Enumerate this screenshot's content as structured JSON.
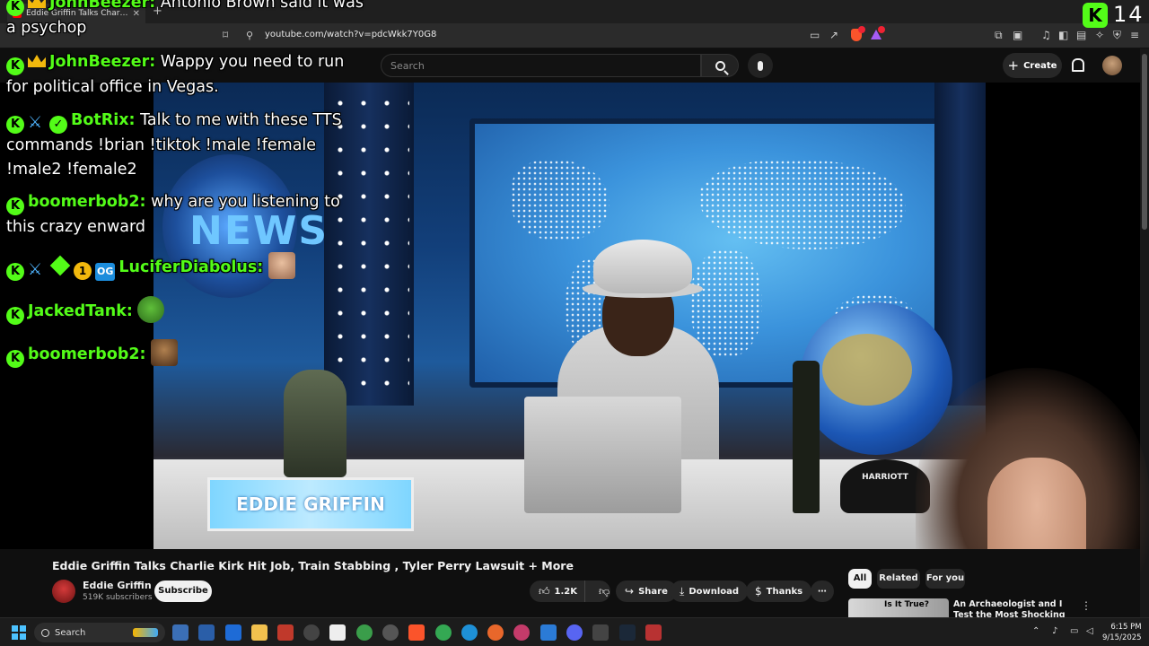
{
  "browser": {
    "tab_title": "Eddie Griffin Talks Charlie Kirk...",
    "url": "youtube.com/watch?v=pdcWkk7Y0G8"
  },
  "youtube": {
    "search_placeholder": "Search",
    "create_label": "Create"
  },
  "overlay": {
    "viewer_count": "14",
    "chat": [
      {
        "name": "JohnBeezer:",
        "message": "Antonio Brown said it was a psychop"
      },
      {
        "name": "JohnBeezer:",
        "message": "Wappy you need to run for political office in Vegas."
      },
      {
        "name": "BotRix:",
        "message": "Talk to me with these TTS commands !brian !tiktok !male !female !male2 !female2"
      },
      {
        "name": "boomerbob2:",
        "message": "why are you listening to this crazy enward"
      },
      {
        "name": "LuciferDiabolus:",
        "message": ""
      },
      {
        "name": "JackedTank:",
        "message": ""
      },
      {
        "name": "boomerbob2:",
        "message": ""
      }
    ]
  },
  "video": {
    "title": "Eddie Griffin Talks Charlie Kirk Hit Job, Train Stabbing , Tyler Perry Lawsuit + More",
    "channel": "Eddie Griffin",
    "subscribers": "519K subscribers",
    "subscribe_label": "Subscribe",
    "likes": "1.2K",
    "share_label": "Share",
    "download_label": "Download",
    "thanks_label": "Thanks",
    "more_label": "⋯"
  },
  "video_scene": {
    "news_text": "NEWS",
    "sign_text": "EDDIE GRIFFIN",
    "cap_text": "HARRIOTT"
  },
  "recommendations": {
    "chips": [
      "All",
      "Related",
      "For you"
    ],
    "first": {
      "thumb_text": "Is It True?",
      "title": "An Archaeologist and I Test the Most Shocking Discovery in..."
    }
  },
  "taskbar": {
    "search_label": "Search",
    "time": "6:15 PM",
    "date": "9/15/2025"
  },
  "colors": {
    "kick_green": "#53fc18",
    "yt_bg": "#0f0f0f"
  }
}
